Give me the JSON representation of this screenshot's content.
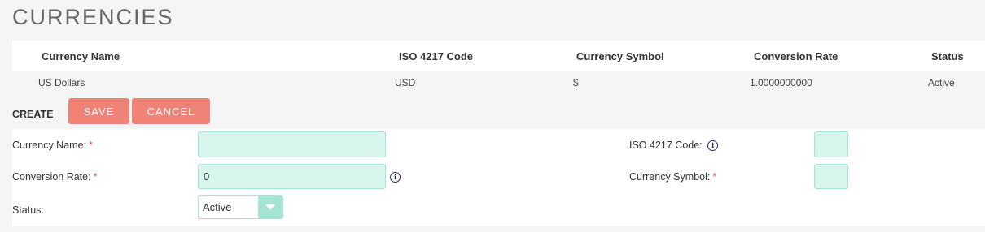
{
  "page": {
    "title": "CURRENCIES"
  },
  "list": {
    "columns": [
      "Currency Name",
      "ISO 4217 Code",
      "Currency Symbol",
      "Conversion Rate",
      "Status"
    ],
    "rows": [
      {
        "name": "US Dollars",
        "iso": "USD",
        "symbol": "$",
        "rate": "1.0000000000",
        "status": "Active"
      }
    ]
  },
  "form": {
    "create_label": "CREATE",
    "save_label": "SAVE",
    "cancel_label": "CANCEL",
    "required_marker": "*",
    "currency_name": {
      "label": "Currency Name:",
      "value": ""
    },
    "conversion_rate": {
      "label": "Conversion Rate:",
      "value": "0"
    },
    "status": {
      "label": "Status:",
      "value": "Active"
    },
    "iso_code": {
      "label": "ISO 4217 Code:",
      "value": ""
    },
    "currency_symbol": {
      "label": "Currency Symbol:",
      "value": ""
    },
    "info_icon_glyph": "i"
  },
  "colors": {
    "button": "#f08377",
    "field_background": "#d8f5ee",
    "field_border": "#a5e3d3",
    "required": "#d9534f"
  },
  "icons": {
    "info": "info-icon",
    "dropdown": "chevron-down-icon"
  }
}
